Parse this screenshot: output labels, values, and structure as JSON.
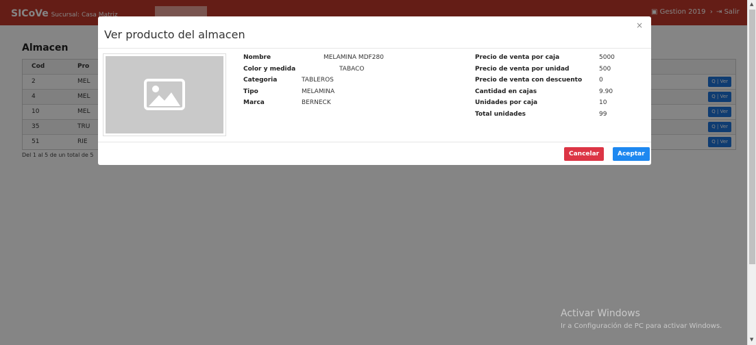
{
  "app": {
    "brand": "SICoVe",
    "sucursal": "Sucursal: Casa Matriz",
    "gestion": "Gestion 2019",
    "salir": "Salir"
  },
  "page": {
    "title": "Almacen",
    "table_headers": [
      "Cod",
      "Pro"
    ],
    "rows": [
      {
        "cod": "2",
        "producto": "MEL"
      },
      {
        "cod": "4",
        "producto": "MEL"
      },
      {
        "cod": "10",
        "producto": "MEL"
      },
      {
        "cod": "35",
        "producto": "TRU"
      },
      {
        "cod": "51",
        "producto": "RIE"
      }
    ],
    "ver_label": "Q | Ver",
    "footer": "Del 1 al 5 de un total de 5"
  },
  "modal": {
    "title": "Ver producto del almacen",
    "close": "×",
    "left_fields": [
      {
        "label": "Nombre",
        "value": "MELAMINA MDF280"
      },
      {
        "label": "Color y medida",
        "value": "TABACO"
      },
      {
        "label": "Categoria",
        "value": "TABLEROS"
      },
      {
        "label": "Tipo",
        "value": "MELAMINA"
      },
      {
        "label": "Marca",
        "value": "BERNECK"
      }
    ],
    "right_fields": [
      {
        "label": "Precio de venta por caja",
        "value": "5000"
      },
      {
        "label": "Precio de venta por unidad",
        "value": "500"
      },
      {
        "label": "Precio de venta con descuento",
        "value": "0"
      },
      {
        "label": "Cantidad en cajas",
        "value": "9.90"
      },
      {
        "label": "Unidades por caja",
        "value": "10"
      },
      {
        "label": "Total unidades",
        "value": "99"
      }
    ],
    "cancel": "Cancelar",
    "accept": "Aceptar"
  },
  "watermark": {
    "line1": "Activar Windows",
    "line2": "Ir a Configuración de PC para activar Windows."
  },
  "colors": {
    "topbar": "#c0392b",
    "primary": "#1e88f0",
    "danger": "#dc3545"
  }
}
